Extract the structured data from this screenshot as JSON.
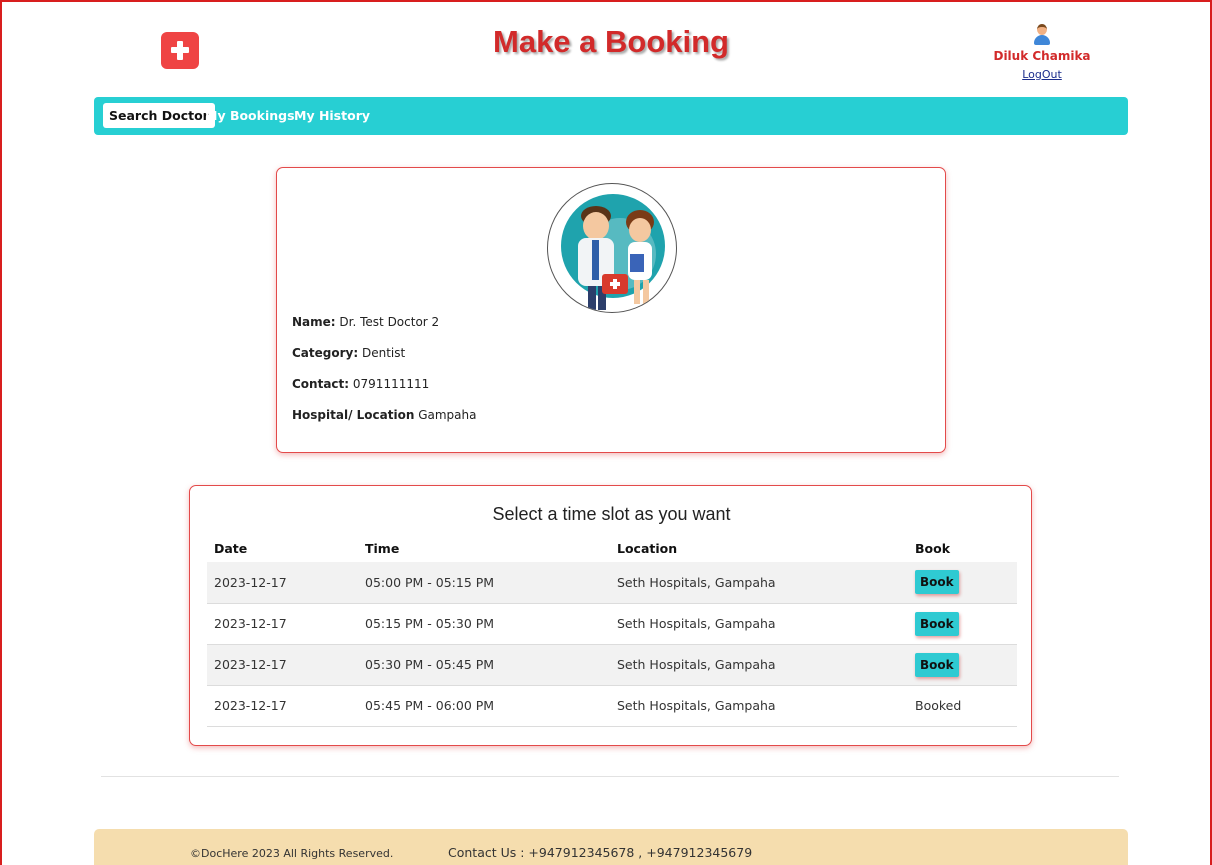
{
  "header": {
    "title": "Make a Booking",
    "user_name": "Diluk Chamika",
    "logout_label": "LogOut"
  },
  "nav": {
    "items": [
      {
        "label": "Search Doctor",
        "active": true
      },
      {
        "label": "My Bookings",
        "active": false
      },
      {
        "label": "My History",
        "active": false
      }
    ]
  },
  "doctor": {
    "name_label": "Name:",
    "name": "Dr. Test Doctor 2",
    "category_label": "Category:",
    "category": "Dentist",
    "contact_label": "Contact:",
    "contact": "0791111111",
    "location_label": "Hospital/ Location",
    "location": "Gampaha"
  },
  "slots": {
    "title": "Select a time slot as you want",
    "columns": [
      "Date",
      "Time",
      "Location",
      "Book"
    ],
    "rows": [
      {
        "date": "2023-12-17",
        "time": "05:00 PM - 05:15 PM",
        "location": "Seth Hospitals, Gampaha",
        "action": "Book",
        "booked": false
      },
      {
        "date": "2023-12-17",
        "time": "05:15 PM - 05:30 PM",
        "location": "Seth Hospitals, Gampaha",
        "action": "Book",
        "booked": false
      },
      {
        "date": "2023-12-17",
        "time": "05:30 PM - 05:45 PM",
        "location": "Seth Hospitals, Gampaha",
        "action": "Book",
        "booked": false
      },
      {
        "date": "2023-12-17",
        "time": "05:45 PM - 06:00 PM",
        "location": "Seth Hospitals, Gampaha",
        "action": "Booked",
        "booked": true
      }
    ]
  },
  "footer": {
    "copyright": "©DocHere 2023 All Rights Reserved.",
    "contact": "Contact Us : +947912345678 , +947912345679"
  },
  "colors": {
    "brand_red": "#d22a2a",
    "nav_teal": "#27cfd3",
    "button_teal": "#2fcad2",
    "footer_bg": "#f5ddae"
  },
  "icons": {
    "logo": "medical-cross-icon",
    "user": "user-avatar-icon",
    "doctor": "doctors-illustration"
  }
}
